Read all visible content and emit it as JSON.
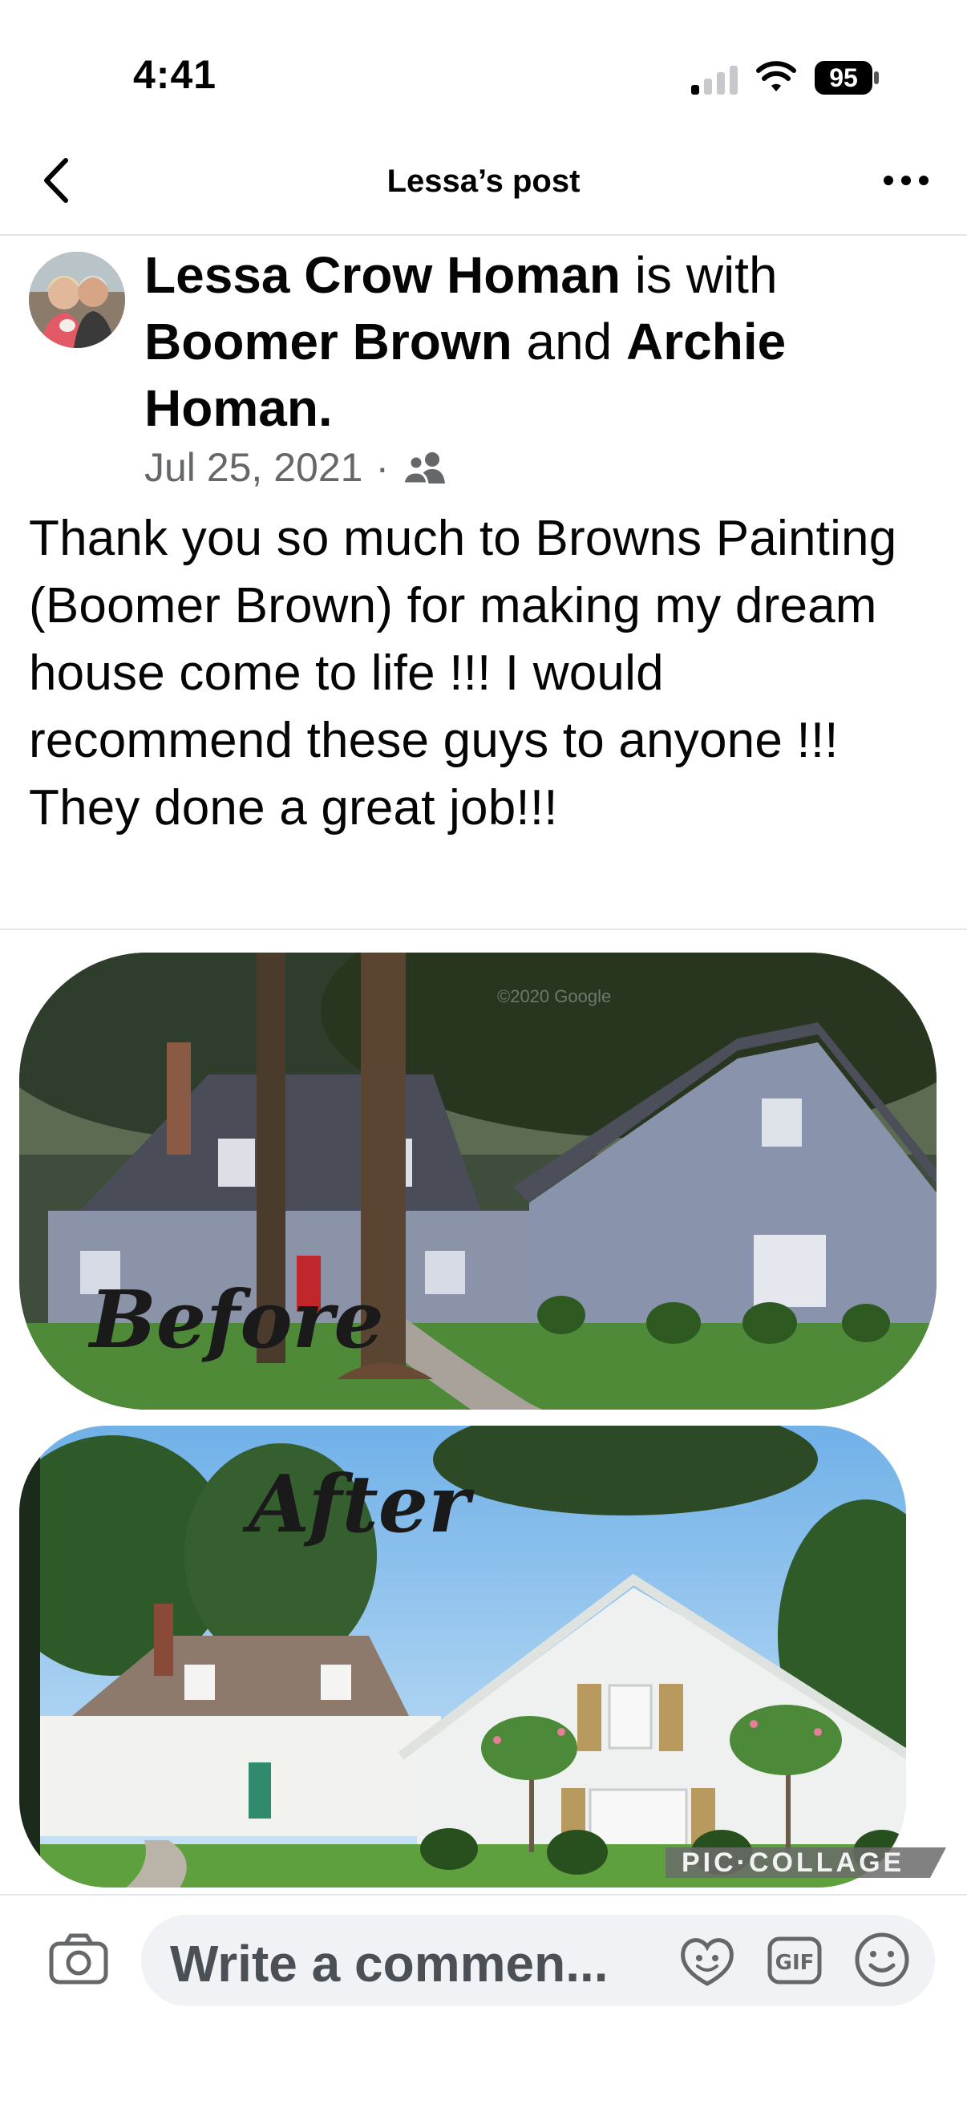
{
  "status_bar": {
    "time": "4:41",
    "battery": "95"
  },
  "header": {
    "title": "Lessa’s post"
  },
  "post": {
    "author": "Lessa Crow Homan",
    "with_word": " is with ",
    "tagged_1": "Boomer Brown",
    "and_word": " and ",
    "tagged_2": "Archie Homan",
    "period": ".",
    "date": "Jul 25, 2021",
    "separator": "·",
    "text": "Thank you so much to Browns Painting (Boomer Brown) for making my dream house come to life !!!  I would recommend these guys to anyone !!! They done a great job!!!",
    "image": {
      "before_caption": "Before",
      "after_caption": "After",
      "watermark": "PIC·COLLAGE",
      "google_mark": "©2020 Google"
    }
  },
  "composer": {
    "placeholder": "Write a commen..."
  },
  "colors": {
    "accent": "#050505",
    "meta": "#65676b",
    "composer_bg": "#f0f2f5"
  },
  "icons": [
    "back-chevron-icon",
    "more-dots-icon",
    "friends-audience-icon",
    "camera-icon",
    "avatar-sticker-icon",
    "gif-icon",
    "emoji-icon",
    "signal-icon",
    "wifi-icon",
    "battery-icon"
  ]
}
